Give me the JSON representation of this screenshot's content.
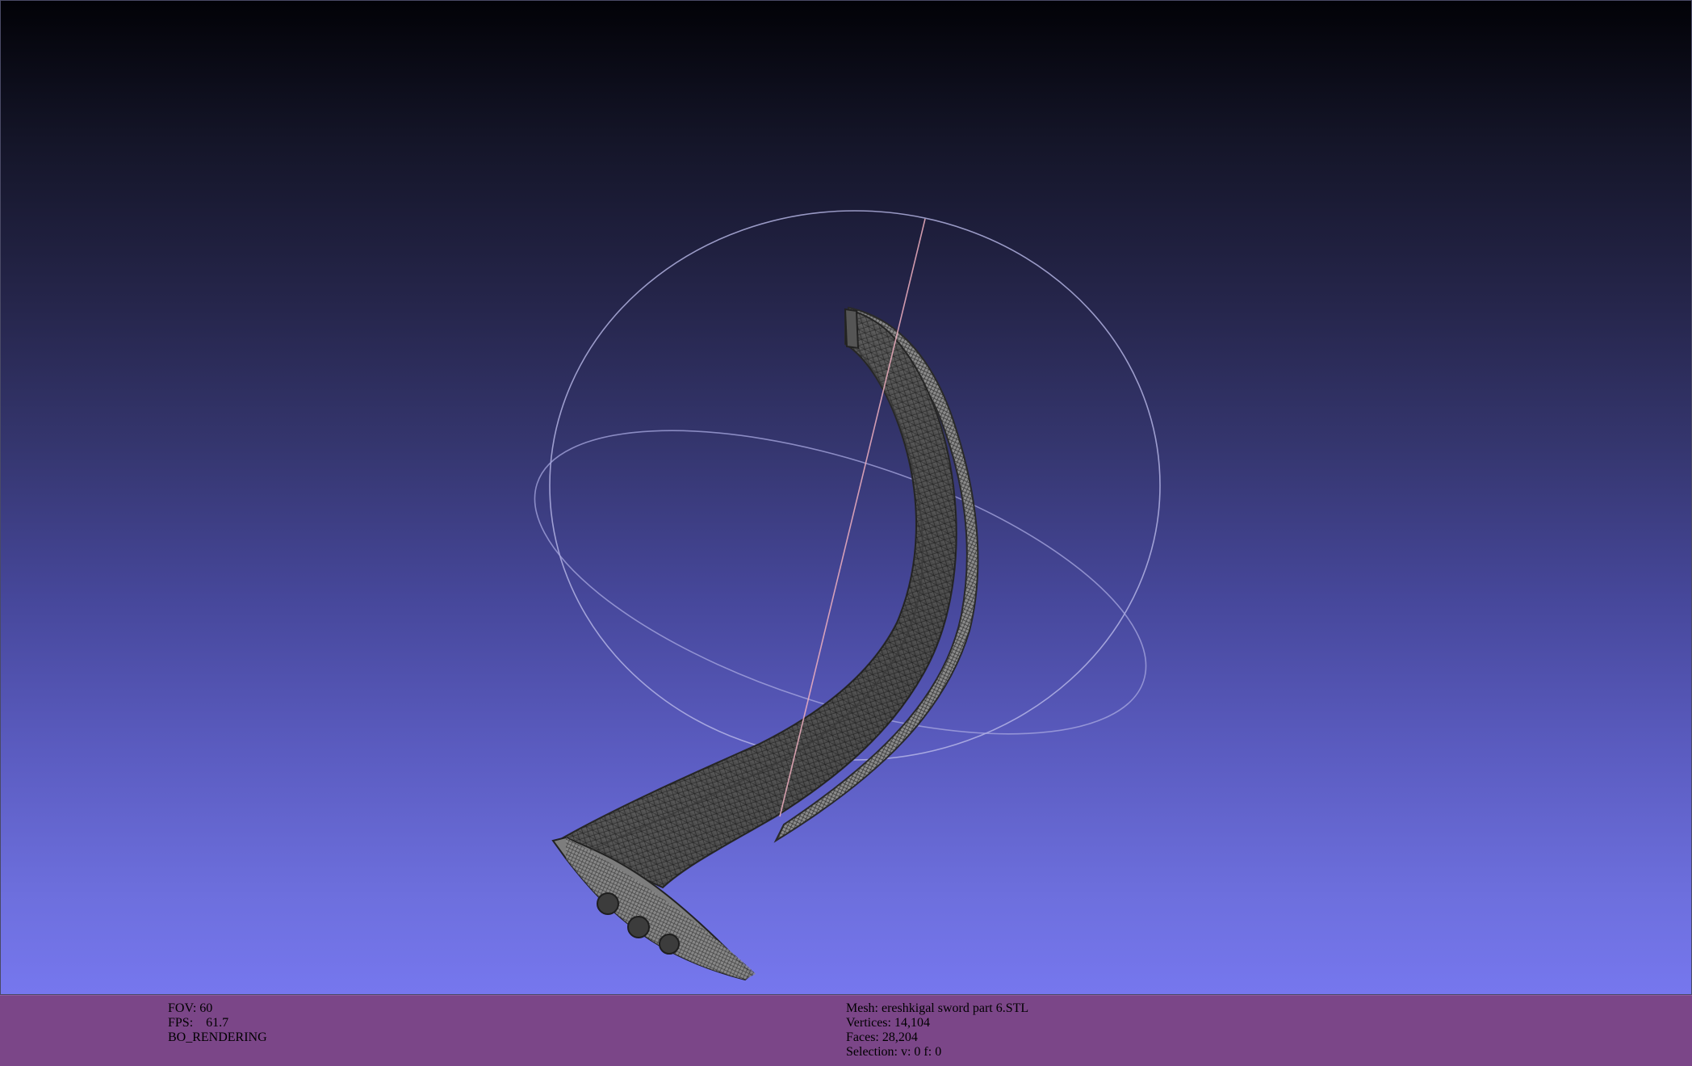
{
  "viewer": {
    "background_top_color": "#020207",
    "background_bottom_color": "#7677ee",
    "mesh_color": "#6b6b6b",
    "wireframe_color": "#222222",
    "trackball_color": "#b9b9e8",
    "axis_color": "#f0b0c0"
  },
  "status": {
    "left": {
      "fov": "FOV: 60",
      "fps": "FPS:    61.7",
      "mode": "BO_RENDERING"
    },
    "right": {
      "mesh": "Mesh: ereshkigal sword part 6.STL",
      "vertices": "Vertices: 14,104",
      "faces": "Faces: 28,204",
      "selection": "Selection: v: 0 f: 0"
    }
  }
}
